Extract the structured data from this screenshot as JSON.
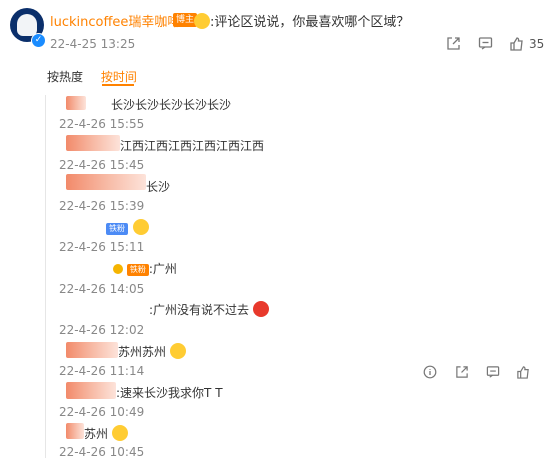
{
  "post": {
    "author": "luckincoffee瑞幸咖啡",
    "badge": "博主",
    "text": "评论区说说，你最喜欢哪个区域？",
    "time": "22-4-25 13:25",
    "like_count": "35"
  },
  "tabs": [
    {
      "label": "按热度",
      "active": false
    },
    {
      "label": "按时间",
      "active": true
    }
  ],
  "replies": [
    {
      "text": "长沙长沙长沙长沙长沙",
      "time": "22-4-26 15:55"
    },
    {
      "text": "江西江西江西江西江西江西",
      "time": "22-4-26 15:45"
    },
    {
      "text": "长沙",
      "time": "22-4-26 15:39"
    },
    {
      "tag": "铁粉",
      "time": "22-4-26 15:11"
    },
    {
      "tag": "铁粉",
      "text": ":广州",
      "time": "22-4-26 14:05"
    },
    {
      "text": ":广州没有说不过去",
      "time": "22-4-26 12:02"
    },
    {
      "text": "苏州苏州",
      "time": "22-4-26 11:14"
    },
    {
      "text": ":速来长沙我求你T T",
      "time": "22-4-26 10:49"
    },
    {
      "text": "苏州",
      "time": "22-4-26 10:45"
    }
  ],
  "icons": {
    "share": "share-icon",
    "comment": "comment-icon",
    "like": "like-icon",
    "info": "info-icon"
  }
}
